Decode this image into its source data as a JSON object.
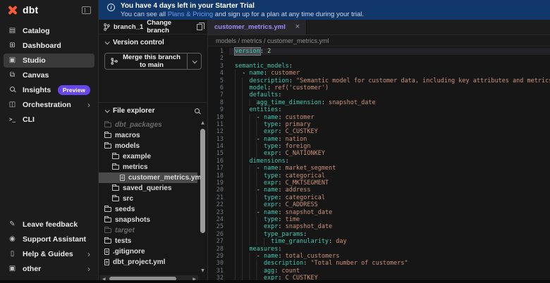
{
  "colors": {
    "accent_orange": "#ff5c35",
    "banner_bg": "#12386b",
    "badge_purple": "#6747ed",
    "link_blue": "#5ea0f0",
    "key_teal": "#3dc9b0",
    "value_orange": "#ce9178"
  },
  "sidebar": {
    "logo_text": "dbt",
    "items": [
      {
        "label": "Catalog",
        "icon": "catalog-icon",
        "active": false
      },
      {
        "label": "Dashboard",
        "icon": "dashboard-icon",
        "active": false
      },
      {
        "label": "Studio",
        "icon": "studio-icon",
        "active": true
      },
      {
        "label": "Canvas",
        "icon": "canvas-icon",
        "active": false
      },
      {
        "label": "Insights",
        "icon": "insights-icon",
        "active": false,
        "badge": "Preview"
      },
      {
        "label": "Orchestration",
        "icon": "orchestration-icon",
        "active": false,
        "chevron": true
      },
      {
        "label": "CLI",
        "icon": "cli-icon",
        "active": false
      }
    ],
    "footer_items": [
      {
        "label": "Leave feedback",
        "icon": "leave-feedback-icon"
      },
      {
        "label": "Support Assistant",
        "icon": "support-assistant-icon"
      },
      {
        "label": "Help & Guides",
        "icon": "help-guides-icon",
        "chevron": true
      },
      {
        "label": "other",
        "icon": "other-icon",
        "chevron": true
      }
    ]
  },
  "banner": {
    "title": "You have 4 days left in your Starter Trial",
    "body_prefix": "You can see all ",
    "link": "Plans & Pricing",
    "body_suffix": " and sign up for a plan at any time during your trial."
  },
  "version_control": {
    "branch": "branch_1",
    "change_branch": "Change branch",
    "section_title": "Version control",
    "merge_button": "Merge this branch to main"
  },
  "file_explorer": {
    "section_title": "File explorer",
    "items": [
      {
        "label": "dbt_packages",
        "type": "folder",
        "indent": 0,
        "dim": true
      },
      {
        "label": "macros",
        "type": "folder",
        "indent": 0
      },
      {
        "label": "models",
        "type": "folder",
        "indent": 0
      },
      {
        "label": "example",
        "type": "folder",
        "indent": 1
      },
      {
        "label": "metrics",
        "type": "folder",
        "indent": 1
      },
      {
        "label": "customer_metrics.yml",
        "type": "file",
        "indent": 2,
        "selected": true
      },
      {
        "label": "saved_queries",
        "type": "folder",
        "indent": 1
      },
      {
        "label": "src",
        "type": "folder",
        "indent": 1
      },
      {
        "label": "seeds",
        "type": "folder",
        "indent": 0
      },
      {
        "label": "snapshots",
        "type": "folder",
        "indent": 0
      },
      {
        "label": "target",
        "type": "folder",
        "indent": 0,
        "dim": true
      },
      {
        "label": "tests",
        "type": "folder",
        "indent": 0
      },
      {
        "label": ".gitignore",
        "type": "file",
        "indent": 0
      },
      {
        "label": "dbt_project.yml",
        "type": "file",
        "indent": 0
      }
    ]
  },
  "editor": {
    "tab": "customer_metrics.yml",
    "breadcrumb": "models / metrics / customer_metrics.yml",
    "lines": [
      {
        "n": 1,
        "ind": 0,
        "current": true,
        "tokens": [
          [
            "hk",
            "version"
          ],
          [
            "p",
            ":"
          ],
          [
            "n",
            " 2"
          ]
        ]
      },
      {
        "n": 2,
        "ind": 0,
        "tokens": []
      },
      {
        "n": 3,
        "ind": 0,
        "tokens": [
          [
            "k",
            "semantic_models"
          ],
          [
            "p",
            ":"
          ]
        ]
      },
      {
        "n": 4,
        "ind": 2,
        "tokens": [
          [
            "d",
            "- "
          ],
          [
            "k",
            "name"
          ],
          [
            "p",
            ":"
          ],
          [
            "v",
            " customer"
          ]
        ]
      },
      {
        "n": 5,
        "ind": 4,
        "tokens": [
          [
            "k",
            "description"
          ],
          [
            "p",
            ":"
          ],
          [
            "v",
            " \"Semantic model for customer data, including key attributes and metrics.\""
          ]
        ]
      },
      {
        "n": 6,
        "ind": 4,
        "tokens": [
          [
            "k",
            "model"
          ],
          [
            "p",
            ":"
          ],
          [
            "v",
            " ref('customer')"
          ]
        ]
      },
      {
        "n": 7,
        "ind": 4,
        "tokens": [
          [
            "k",
            "defaults"
          ],
          [
            "p",
            ":"
          ]
        ]
      },
      {
        "n": 8,
        "ind": 6,
        "tokens": [
          [
            "k",
            "agg_time_dimension"
          ],
          [
            "p",
            ":"
          ],
          [
            "v",
            " snapshot_date"
          ]
        ]
      },
      {
        "n": 9,
        "ind": 4,
        "tokens": [
          [
            "k",
            "entities"
          ],
          [
            "p",
            ":"
          ]
        ]
      },
      {
        "n": 10,
        "ind": 6,
        "tokens": [
          [
            "d",
            "- "
          ],
          [
            "k",
            "name"
          ],
          [
            "p",
            ":"
          ],
          [
            "v",
            " customer"
          ]
        ]
      },
      {
        "n": 11,
        "ind": 8,
        "tokens": [
          [
            "k",
            "type"
          ],
          [
            "p",
            ":"
          ],
          [
            "v",
            " primary"
          ]
        ]
      },
      {
        "n": 12,
        "ind": 8,
        "tokens": [
          [
            "k",
            "expr"
          ],
          [
            "p",
            ":"
          ],
          [
            "v",
            " C_CUSTKEY"
          ]
        ]
      },
      {
        "n": 13,
        "ind": 6,
        "tokens": [
          [
            "d",
            "- "
          ],
          [
            "k",
            "name"
          ],
          [
            "p",
            ":"
          ],
          [
            "v",
            " nation"
          ]
        ]
      },
      {
        "n": 14,
        "ind": 8,
        "tokens": [
          [
            "k",
            "type"
          ],
          [
            "p",
            ":"
          ],
          [
            "v",
            " foreign"
          ]
        ]
      },
      {
        "n": 15,
        "ind": 8,
        "tokens": [
          [
            "k",
            "expr"
          ],
          [
            "p",
            ":"
          ],
          [
            "v",
            " C_NATIONKEY"
          ]
        ]
      },
      {
        "n": 16,
        "ind": 4,
        "tokens": [
          [
            "k",
            "dimensions"
          ],
          [
            "p",
            ":"
          ]
        ]
      },
      {
        "n": 17,
        "ind": 6,
        "tokens": [
          [
            "d",
            "- "
          ],
          [
            "k",
            "name"
          ],
          [
            "p",
            ":"
          ],
          [
            "v",
            " market_segment"
          ]
        ]
      },
      {
        "n": 18,
        "ind": 8,
        "tokens": [
          [
            "k",
            "type"
          ],
          [
            "p",
            ":"
          ],
          [
            "v",
            " categorical"
          ]
        ]
      },
      {
        "n": 19,
        "ind": 8,
        "tokens": [
          [
            "k",
            "expr"
          ],
          [
            "p",
            ":"
          ],
          [
            "v",
            " C_MKTSEGMENT"
          ]
        ]
      },
      {
        "n": 20,
        "ind": 6,
        "tokens": [
          [
            "d",
            "- "
          ],
          [
            "k",
            "name"
          ],
          [
            "p",
            ":"
          ],
          [
            "v",
            " address"
          ]
        ]
      },
      {
        "n": 21,
        "ind": 8,
        "tokens": [
          [
            "k",
            "type"
          ],
          [
            "p",
            ":"
          ],
          [
            "v",
            " categorical"
          ]
        ]
      },
      {
        "n": 22,
        "ind": 8,
        "tokens": [
          [
            "k",
            "expr"
          ],
          [
            "p",
            ":"
          ],
          [
            "v",
            " C_ADDRESS"
          ]
        ]
      },
      {
        "n": 23,
        "ind": 6,
        "tokens": [
          [
            "d",
            "- "
          ],
          [
            "k",
            "name"
          ],
          [
            "p",
            ":"
          ],
          [
            "v",
            " snapshot_date"
          ]
        ]
      },
      {
        "n": 24,
        "ind": 8,
        "tokens": [
          [
            "k",
            "type"
          ],
          [
            "p",
            ":"
          ],
          [
            "v",
            " time"
          ]
        ]
      },
      {
        "n": 25,
        "ind": 8,
        "tokens": [
          [
            "k",
            "expr"
          ],
          [
            "p",
            ":"
          ],
          [
            "v",
            " snapshot_date"
          ]
        ]
      },
      {
        "n": 26,
        "ind": 8,
        "tokens": [
          [
            "k",
            "type_params"
          ],
          [
            "p",
            ":"
          ]
        ]
      },
      {
        "n": 27,
        "ind": 10,
        "tokens": [
          [
            "k",
            "time_granularity"
          ],
          [
            "p",
            ":"
          ],
          [
            "v",
            " day"
          ]
        ]
      },
      {
        "n": 28,
        "ind": 4,
        "tokens": [
          [
            "k",
            "measures"
          ],
          [
            "p",
            ":"
          ]
        ]
      },
      {
        "n": 29,
        "ind": 6,
        "tokens": [
          [
            "d",
            "- "
          ],
          [
            "k",
            "name"
          ],
          [
            "p",
            ":"
          ],
          [
            "v",
            " total_customers"
          ]
        ]
      },
      {
        "n": 30,
        "ind": 8,
        "tokens": [
          [
            "k",
            "description"
          ],
          [
            "p",
            ":"
          ],
          [
            "v",
            " \"Total number of customers\""
          ]
        ]
      },
      {
        "n": 31,
        "ind": 8,
        "tokens": [
          [
            "k",
            "agg"
          ],
          [
            "p",
            ":"
          ],
          [
            "v",
            " count"
          ]
        ]
      },
      {
        "n": 32,
        "ind": 8,
        "tokens": [
          [
            "k",
            "expr"
          ],
          [
            "p",
            ":"
          ],
          [
            "v",
            " C_CUSTKEY"
          ]
        ]
      }
    ]
  }
}
